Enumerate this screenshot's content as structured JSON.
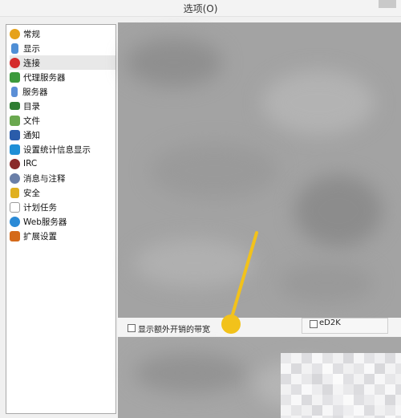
{
  "window": {
    "title": "选项(O)"
  },
  "sidebar": {
    "selected_index": 2,
    "items": [
      {
        "label": "常规",
        "icon": "gear-icon",
        "color": "#e6a21a"
      },
      {
        "label": "显示",
        "icon": "display-icon",
        "color": "#4f8fd6"
      },
      {
        "label": "连接",
        "icon": "connection-icon",
        "color": "#d42a2a"
      },
      {
        "label": "代理服务器",
        "icon": "proxy-icon",
        "color": "#3c9a3c"
      },
      {
        "label": "服务器",
        "icon": "server-icon",
        "color": "#5b8fd6"
      },
      {
        "label": "目录",
        "icon": "folder-icon",
        "color": "#2e7d32"
      },
      {
        "label": "文件",
        "icon": "file-icon",
        "color": "#6aa84f"
      },
      {
        "label": "通知",
        "icon": "notification-icon",
        "color": "#2a5caa"
      },
      {
        "label": "设置统计信息显示",
        "icon": "statistics-icon",
        "color": "#1f8fd6"
      },
      {
        "label": "IRC",
        "icon": "irc-icon",
        "color": "#8a2a2a"
      },
      {
        "label": "消息与注释",
        "icon": "messages-icon",
        "color": "#6a7fa8"
      },
      {
        "label": "安全",
        "icon": "lock-icon",
        "color": "#e0b020"
      },
      {
        "label": "计划任务",
        "icon": "schedule-icon",
        "color": "#9a9a9a"
      },
      {
        "label": "Web服务器",
        "icon": "web-icon",
        "color": "#2a8ad6"
      },
      {
        "label": "扩展设置",
        "icon": "extension-icon",
        "color": "#d46a1a"
      }
    ]
  },
  "content": {
    "bandwidth_checkbox_label": "显示额外开销的带宽",
    "ed2k_checkbox_label": "eD2K"
  },
  "annotation": {
    "color": "#f2c21b"
  }
}
